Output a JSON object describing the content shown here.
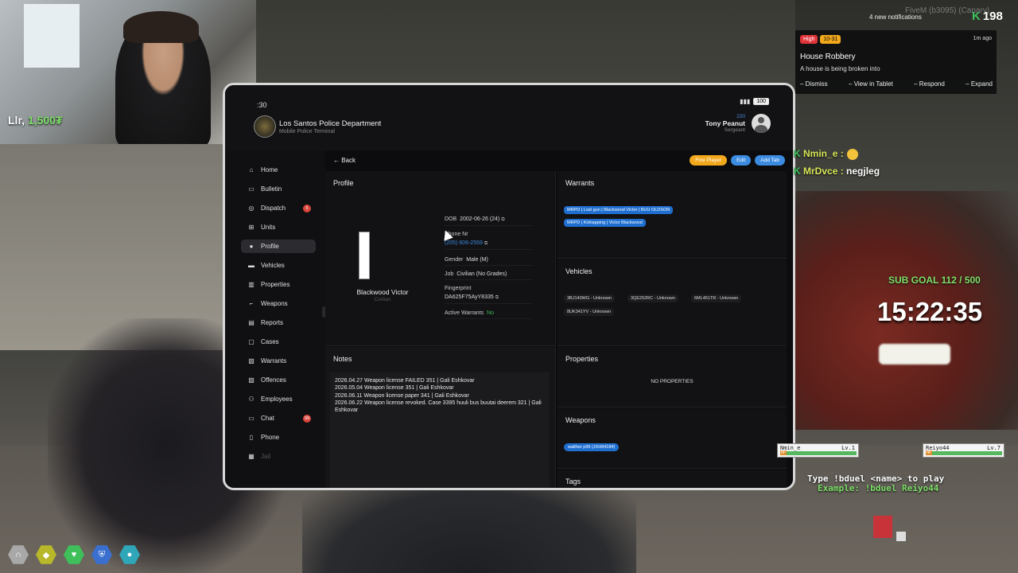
{
  "stream": {
    "watermark": "FiveM (b3095) (Canary)",
    "webcam_label_name": "Llr,",
    "webcam_label_amount": "1,500",
    "webcam_label_unit": "₮",
    "notifications_count": "4 new notifications",
    "k_counter": "198",
    "sub_goal": "SUB GOAL 112 / 500",
    "timer": "15:22:35",
    "duel_help": "Type !bduel <name> to play",
    "duel_example": "Example: !bduel Reiyo44"
  },
  "chat": [
    {
      "name": "Nmin_e :",
      "message": ""
    },
    {
      "name": "MrDvce :",
      "message": "negjleg"
    }
  ],
  "duel": [
    {
      "name": "Nmin_e",
      "level": "Lv.1",
      "hp_label": "HP",
      "hp": 1.0
    },
    {
      "name": "Reiyo44",
      "level": "Lv.7",
      "hp_label": "HP",
      "hp": 1.0
    }
  ],
  "alert": {
    "priority": "High",
    "code": "10-31",
    "time": "1m ago",
    "title": "House Robbery",
    "description": "A house is being broken into",
    "actions": [
      "Dismiss",
      "View in Tablet",
      "Respond",
      "Expand"
    ]
  },
  "tablet": {
    "status_time": ":30",
    "battery": "100",
    "department": "Los Santos Police Department",
    "department_sub": "Mobile Police Terminal",
    "user": {
      "id": "220",
      "name": "Tony Peanut",
      "rank": "Sergeant"
    },
    "nav": [
      {
        "label": "Home",
        "icon": "home-icon",
        "glyph": "⌂"
      },
      {
        "label": "Bulletin",
        "icon": "bulletin-icon",
        "glyph": "▭"
      },
      {
        "label": "Dispatch",
        "icon": "dispatch-icon",
        "glyph": "◎",
        "badge": "5"
      },
      {
        "label": "Units",
        "icon": "units-icon",
        "glyph": "⊞"
      },
      {
        "label": "Profile",
        "icon": "user-icon",
        "glyph": "●",
        "active": true
      },
      {
        "label": "Vehicles",
        "icon": "car-icon",
        "glyph": "▬"
      },
      {
        "label": "Properties",
        "icon": "building-icon",
        "glyph": "▥"
      },
      {
        "label": "Weapons",
        "icon": "gun-icon",
        "glyph": "⌐"
      },
      {
        "label": "Reports",
        "icon": "reports-icon",
        "glyph": "▤"
      },
      {
        "label": "Cases",
        "icon": "cases-icon",
        "glyph": "▢"
      },
      {
        "label": "Warrants",
        "icon": "warrants-icon",
        "glyph": "▧"
      },
      {
        "label": "Offences",
        "icon": "offences-icon",
        "glyph": "▨"
      },
      {
        "label": "Employees",
        "icon": "employees-icon",
        "glyph": "⚇"
      },
      {
        "label": "Chat",
        "icon": "chat-icon",
        "glyph": "▭",
        "badge": "99"
      },
      {
        "label": "Phone",
        "icon": "phone-icon",
        "glyph": "▯"
      },
      {
        "label": "Jail",
        "icon": "jail-icon",
        "glyph": "▦",
        "disabled": true
      }
    ],
    "back_label": "Back",
    "buttons": {
      "fine": "Fine Player",
      "edit": "Edit",
      "add_tab": "Add Tab"
    },
    "profile": {
      "section_title": "Profile",
      "name": "Blackwood Victor",
      "job_short": "Civilian",
      "dob_label": "DOB",
      "dob": "2002-06-26 (24)",
      "phone_label": "Phone Nr",
      "phone": "(205) 606-2559",
      "gender_label": "Gender",
      "gender": "Male (M)",
      "job_label": "Job",
      "job": "Civilian (No Grades)",
      "fingerprint_label": "Fingerprint",
      "fingerprint": "DA625F75AyY8335",
      "warrants_label": "Active Warrants",
      "warrants": "No"
    },
    "warrants": {
      "title": "Warrants",
      "items": [
        "MRPD | Lost gun | Blackwood Victor | BUU OLDSON",
        "MRPD | Kidnapping | Victor Blackwood"
      ]
    },
    "vehicles": {
      "title": "Vehicles",
      "items": [
        "3BJ140WG - Unknown",
        "3QE252RC - Unknown",
        "6ML451TR - Unknown",
        "8UK341YV - Unknown"
      ]
    },
    "notes": {
      "title": "Notes",
      "lines": [
        "2026.04.27 Weapon license FAILED 351 | Gali Eshkovar",
        "2026.05.04 Weapon license 351 | Gali Eshkovar",
        "2026.06.11 Weapon license paper 341 | Gali Eshkovar",
        "2026.06.22 Weapon license revoked. Case 3395 huuli bus buutai deerem 321 | Gali Eshkovar"
      ]
    },
    "properties": {
      "title": "Properties",
      "empty": "NO PROPERTIES"
    },
    "weapons": {
      "title": "Weapons",
      "items": [
        "walther p99 (JXH94184)"
      ]
    },
    "tags": {
      "title": "Tags"
    }
  },
  "hud": [
    "headset-icon",
    "hexagon-icon",
    "heart-icon",
    "shield-icon",
    "water-icon"
  ],
  "colors": {
    "accent": "#3b8be0",
    "warning": "#f2a81d",
    "danger": "#e0343b",
    "success": "#3dbb5a"
  }
}
